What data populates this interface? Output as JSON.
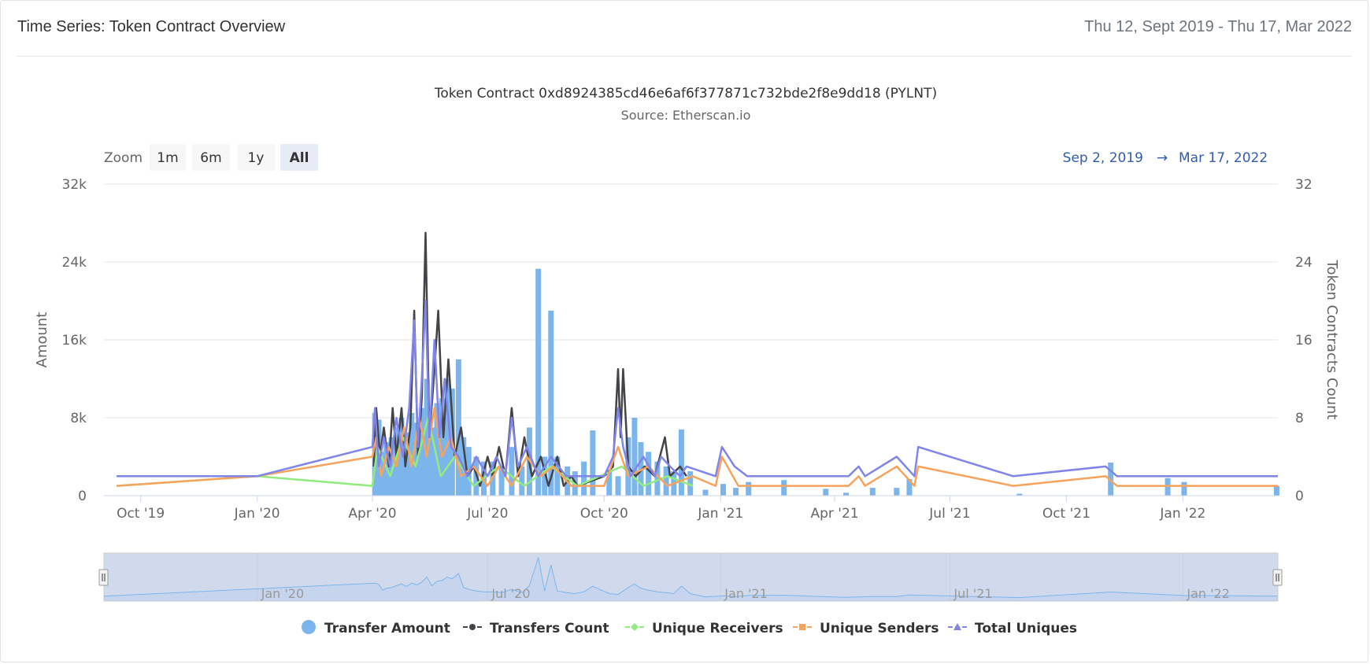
{
  "header": {
    "title": "Time Series: Token Contract Overview",
    "date_range": "Thu 12, Sept 2019 - Thu 17, Mar 2022"
  },
  "chart_data": {
    "type": "bar-line",
    "title": "Token Contract 0xd8924385cd46e6af6f377871c732bde2f8e9dd18 (PYLNT)",
    "subtitle": "Source: Etherscan.io",
    "zoom": {
      "label": "Zoom",
      "buttons": [
        "1m",
        "6m",
        "1y",
        "All"
      ],
      "selected": "All"
    },
    "range_selector": {
      "from": "Sep 2, 2019",
      "arrow": "→",
      "to": "Mar 17, 2022"
    },
    "x_axis": {
      "range": [
        "2019-09-02",
        "2022-03-17"
      ],
      "ticks": [
        {
          "date": "2019-10-01",
          "label": "Oct '19"
        },
        {
          "date": "2020-01-01",
          "label": "Jan '20"
        },
        {
          "date": "2020-04-01",
          "label": "Apr '20"
        },
        {
          "date": "2020-07-01",
          "label": "Jul '20"
        },
        {
          "date": "2020-10-01",
          "label": "Oct '20"
        },
        {
          "date": "2021-01-01",
          "label": "Jan '21"
        },
        {
          "date": "2021-04-01",
          "label": "Apr '21"
        },
        {
          "date": "2021-07-01",
          "label": "Jul '21"
        },
        {
          "date": "2021-10-01",
          "label": "Oct '21"
        },
        {
          "date": "2022-01-01",
          "label": "Jan '22"
        }
      ]
    },
    "y_left": {
      "label": "Amount",
      "min": 0,
      "max": 32000,
      "ticks": [
        {
          "v": 0,
          "label": "0"
        },
        {
          "v": 8000,
          "label": "8k"
        },
        {
          "v": 16000,
          "label": "16k"
        },
        {
          "v": 24000,
          "label": "24k"
        },
        {
          "v": 32000,
          "label": "32k"
        }
      ]
    },
    "y_right": {
      "label": "Token Contracts Count",
      "min": 0,
      "max": 32,
      "ticks": [
        {
          "v": 0,
          "label": "0"
        },
        {
          "v": 8,
          "label": "8"
        },
        {
          "v": 16,
          "label": "16"
        },
        {
          "v": 24,
          "label": "24"
        },
        {
          "v": 32,
          "label": "32"
        }
      ]
    },
    "navigator": {
      "labels": [
        {
          "date": "2020-01-01",
          "label": "Jan '20"
        },
        {
          "date": "2020-07-01",
          "label": "Jul '20"
        },
        {
          "date": "2021-01-01",
          "label": "Jan '21"
        },
        {
          "date": "2021-07-01",
          "label": "Jul '21"
        },
        {
          "date": "2022-01-01",
          "label": "Jan '22"
        }
      ]
    },
    "grid": true,
    "legend_position": "bottom-center",
    "series": [
      {
        "name": "Transfer Amount",
        "type": "bar",
        "axis": "left",
        "color": "#7cb5ec",
        "points": [
          [
            "2020-04-03",
            8500
          ],
          [
            "2020-04-06",
            7800
          ],
          [
            "2020-04-09",
            4500
          ],
          [
            "2020-04-12",
            5500
          ],
          [
            "2020-04-16",
            6000
          ],
          [
            "2020-04-20",
            7000
          ],
          [
            "2020-04-24",
            8000
          ],
          [
            "2020-04-28",
            6500
          ],
          [
            "2020-05-02",
            8500
          ],
          [
            "2020-05-06",
            7500
          ],
          [
            "2020-05-10",
            9000
          ],
          [
            "2020-05-14",
            12000
          ],
          [
            "2020-05-18",
            7000
          ],
          [
            "2020-05-22",
            9500
          ],
          [
            "2020-05-26",
            10000
          ],
          [
            "2020-05-30",
            12000
          ],
          [
            "2020-06-03",
            11000
          ],
          [
            "2020-06-08",
            14000
          ],
          [
            "2020-06-12",
            6000
          ],
          [
            "2020-06-16",
            5000
          ],
          [
            "2020-06-22",
            4000
          ],
          [
            "2020-06-28",
            3500
          ],
          [
            "2020-07-05",
            3500
          ],
          [
            "2020-07-12",
            3000
          ],
          [
            "2020-07-20",
            5000
          ],
          [
            "2020-07-28",
            3000
          ],
          [
            "2020-08-03",
            7000
          ],
          [
            "2020-08-10",
            23300
          ],
          [
            "2020-08-15",
            4000
          ],
          [
            "2020-08-20",
            19000
          ],
          [
            "2020-08-25",
            4000
          ],
          [
            "2020-09-02",
            3000
          ],
          [
            "2020-09-08",
            2500
          ],
          [
            "2020-09-15",
            3500
          ],
          [
            "2020-09-22",
            6700
          ],
          [
            "2020-10-05",
            2500
          ],
          [
            "2020-10-12",
            2000
          ],
          [
            "2020-10-20",
            6000
          ],
          [
            "2020-10-25",
            8000
          ],
          [
            "2020-10-30",
            5500
          ],
          [
            "2020-11-05",
            4500
          ],
          [
            "2020-11-12",
            3500
          ],
          [
            "2020-11-19",
            3000
          ],
          [
            "2020-11-25",
            2500
          ],
          [
            "2020-12-01",
            6800
          ],
          [
            "2020-12-08",
            2500
          ],
          [
            "2020-12-20",
            600
          ],
          [
            "2021-01-03",
            1200
          ],
          [
            "2021-01-13",
            800
          ],
          [
            "2021-01-23",
            1400
          ],
          [
            "2021-02-20",
            1600
          ],
          [
            "2021-03-25",
            700
          ],
          [
            "2021-04-10",
            300
          ],
          [
            "2021-05-01",
            800
          ],
          [
            "2021-05-20",
            800
          ],
          [
            "2021-05-30",
            1700
          ],
          [
            "2021-08-25",
            200
          ],
          [
            "2021-11-05",
            3400
          ],
          [
            "2021-12-20",
            1800
          ],
          [
            "2022-01-02",
            1400
          ],
          [
            "2022-03-16",
            1000
          ]
        ]
      },
      {
        "name": "Transfers Count",
        "type": "line",
        "axis": "right",
        "color": "#434348",
        "points": [
          [
            "2020-04-02",
            3
          ],
          [
            "2020-04-04",
            9
          ],
          [
            "2020-04-07",
            4
          ],
          [
            "2020-04-10",
            7
          ],
          [
            "2020-04-14",
            3
          ],
          [
            "2020-04-17",
            9
          ],
          [
            "2020-04-20",
            4
          ],
          [
            "2020-04-24",
            9
          ],
          [
            "2020-04-27",
            3
          ],
          [
            "2020-05-01",
            7
          ],
          [
            "2020-05-04",
            19
          ],
          [
            "2020-05-07",
            4
          ],
          [
            "2020-05-10",
            10
          ],
          [
            "2020-05-13",
            27
          ],
          [
            "2020-05-16",
            6
          ],
          [
            "2020-05-20",
            13
          ],
          [
            "2020-05-23",
            19
          ],
          [
            "2020-05-27",
            6
          ],
          [
            "2020-05-31",
            14
          ],
          [
            "2020-06-05",
            4
          ],
          [
            "2020-06-10",
            7
          ],
          [
            "2020-06-15",
            2
          ],
          [
            "2020-06-20",
            3
          ],
          [
            "2020-06-25",
            1
          ],
          [
            "2020-07-01",
            4
          ],
          [
            "2020-07-05",
            2
          ],
          [
            "2020-07-10",
            5
          ],
          [
            "2020-07-15",
            2
          ],
          [
            "2020-07-20",
            9
          ],
          [
            "2020-07-25",
            2
          ],
          [
            "2020-07-30",
            6
          ],
          [
            "2020-08-05",
            2
          ],
          [
            "2020-08-12",
            4
          ],
          [
            "2020-08-18",
            1
          ],
          [
            "2020-08-25",
            4
          ],
          [
            "2020-08-30",
            1
          ],
          [
            "2020-09-05",
            2
          ],
          [
            "2020-09-10",
            1
          ],
          [
            "2020-10-01",
            2
          ],
          [
            "2020-10-08",
            3
          ],
          [
            "2020-10-12",
            13
          ],
          [
            "2020-10-14",
            6
          ],
          [
            "2020-10-16",
            13
          ],
          [
            "2020-10-20",
            3
          ],
          [
            "2020-10-26",
            2
          ],
          [
            "2020-11-02",
            3
          ],
          [
            "2020-11-10",
            2
          ],
          [
            "2020-11-18",
            6
          ],
          [
            "2020-11-22",
            2
          ],
          [
            "2020-11-30",
            3
          ],
          [
            "2020-12-05",
            2
          ]
        ]
      },
      {
        "name": "Unique Receivers",
        "type": "line",
        "axis": "right",
        "color": "#90ed7d",
        "points": [
          [
            "2019-09-12",
            1
          ],
          [
            "2020-01-01",
            2
          ],
          [
            "2020-04-01",
            1
          ],
          [
            "2020-04-05",
            5
          ],
          [
            "2020-04-15",
            2
          ],
          [
            "2020-04-25",
            6
          ],
          [
            "2020-05-05",
            3
          ],
          [
            "2020-05-15",
            8
          ],
          [
            "2020-05-25",
            2
          ],
          [
            "2020-06-05",
            4
          ],
          [
            "2020-06-20",
            1
          ],
          [
            "2020-07-10",
            3
          ],
          [
            "2020-07-30",
            1
          ],
          [
            "2020-08-20",
            3
          ],
          [
            "2020-09-10",
            1
          ],
          [
            "2020-10-15",
            3
          ],
          [
            "2020-11-01",
            1
          ],
          [
            "2020-11-20",
            2
          ],
          [
            "2020-12-10",
            1
          ]
        ]
      },
      {
        "name": "Unique Senders",
        "type": "line",
        "axis": "right",
        "color": "#f7a35c",
        "points": [
          [
            "2019-09-12",
            1
          ],
          [
            "2020-01-01",
            2
          ],
          [
            "2020-04-01",
            4
          ],
          [
            "2020-04-04",
            6
          ],
          [
            "2020-04-08",
            2
          ],
          [
            "2020-04-14",
            5
          ],
          [
            "2020-04-20",
            3
          ],
          [
            "2020-04-26",
            7
          ],
          [
            "2020-05-02",
            3
          ],
          [
            "2020-05-08",
            8
          ],
          [
            "2020-05-14",
            4
          ],
          [
            "2020-05-20",
            9
          ],
          [
            "2020-05-26",
            4
          ],
          [
            "2020-06-02",
            6
          ],
          [
            "2020-06-10",
            2
          ],
          [
            "2020-06-20",
            3
          ],
          [
            "2020-07-01",
            1
          ],
          [
            "2020-07-10",
            3
          ],
          [
            "2020-07-20",
            1
          ],
          [
            "2020-08-01",
            4
          ],
          [
            "2020-08-12",
            2
          ],
          [
            "2020-08-22",
            3
          ],
          [
            "2020-09-05",
            1
          ],
          [
            "2020-10-01",
            1
          ],
          [
            "2020-10-12",
            5
          ],
          [
            "2020-10-20",
            2
          ],
          [
            "2020-11-05",
            3
          ],
          [
            "2020-11-20",
            1
          ],
          [
            "2020-12-10",
            2
          ],
          [
            "2020-12-28",
            1
          ],
          [
            "2021-01-02",
            4
          ],
          [
            "2021-01-15",
            1
          ],
          [
            "2021-04-12",
            1
          ],
          [
            "2021-04-20",
            2
          ],
          [
            "2021-04-25",
            1
          ],
          [
            "2021-05-20",
            3
          ],
          [
            "2021-06-03",
            1
          ],
          [
            "2021-06-06",
            3
          ],
          [
            "2021-08-20",
            1
          ],
          [
            "2021-11-01",
            2
          ],
          [
            "2021-11-10",
            1
          ],
          [
            "2022-03-17",
            1
          ]
        ]
      },
      {
        "name": "Total Uniques",
        "type": "line",
        "axis": "right",
        "color": "#8085e9",
        "points": [
          [
            "2019-09-12",
            2
          ],
          [
            "2020-01-01",
            2
          ],
          [
            "2020-04-01",
            5
          ],
          [
            "2020-04-03",
            9
          ],
          [
            "2020-04-06",
            3
          ],
          [
            "2020-04-10",
            6
          ],
          [
            "2020-04-15",
            3
          ],
          [
            "2020-04-20",
            8
          ],
          [
            "2020-04-25",
            4
          ],
          [
            "2020-04-30",
            9
          ],
          [
            "2020-05-04",
            18
          ],
          [
            "2020-05-07",
            5
          ],
          [
            "2020-05-10",
            12
          ],
          [
            "2020-05-13",
            20
          ],
          [
            "2020-05-16",
            6
          ],
          [
            "2020-05-20",
            16
          ],
          [
            "2020-05-24",
            6
          ],
          [
            "2020-05-28",
            12
          ],
          [
            "2020-06-02",
            5
          ],
          [
            "2020-06-08",
            4
          ],
          [
            "2020-06-15",
            2
          ],
          [
            "2020-06-22",
            4
          ],
          [
            "2020-07-01",
            2
          ],
          [
            "2020-07-08",
            4
          ],
          [
            "2020-07-15",
            2
          ],
          [
            "2020-07-20",
            8
          ],
          [
            "2020-07-25",
            3
          ],
          [
            "2020-08-01",
            5
          ],
          [
            "2020-08-10",
            2
          ],
          [
            "2020-08-20",
            4
          ],
          [
            "2020-09-01",
            2
          ],
          [
            "2020-10-01",
            2
          ],
          [
            "2020-10-08",
            4
          ],
          [
            "2020-10-12",
            9
          ],
          [
            "2020-10-16",
            5
          ],
          [
            "2020-10-22",
            2
          ],
          [
            "2020-11-01",
            4
          ],
          [
            "2020-11-10",
            2
          ],
          [
            "2020-11-15",
            4
          ],
          [
            "2020-11-22",
            3
          ],
          [
            "2020-11-30",
            2
          ],
          [
            "2020-12-05",
            3
          ],
          [
            "2020-12-28",
            2
          ],
          [
            "2021-01-02",
            5
          ],
          [
            "2021-01-12",
            3
          ],
          [
            "2021-01-22",
            2
          ],
          [
            "2021-04-12",
            2
          ],
          [
            "2021-04-20",
            3
          ],
          [
            "2021-04-25",
            2
          ],
          [
            "2021-05-20",
            4
          ],
          [
            "2021-06-03",
            2
          ],
          [
            "2021-06-06",
            5
          ],
          [
            "2021-08-20",
            2
          ],
          [
            "2021-11-01",
            3
          ],
          [
            "2021-11-10",
            2
          ],
          [
            "2022-03-17",
            2
          ]
        ]
      }
    ]
  },
  "colors": {
    "accent": "#335cad",
    "selected_bg": "#e6ebf5",
    "button_bg": "#f7f7f7",
    "navigator_mask": "rgba(102,133,194,0.3)"
  }
}
